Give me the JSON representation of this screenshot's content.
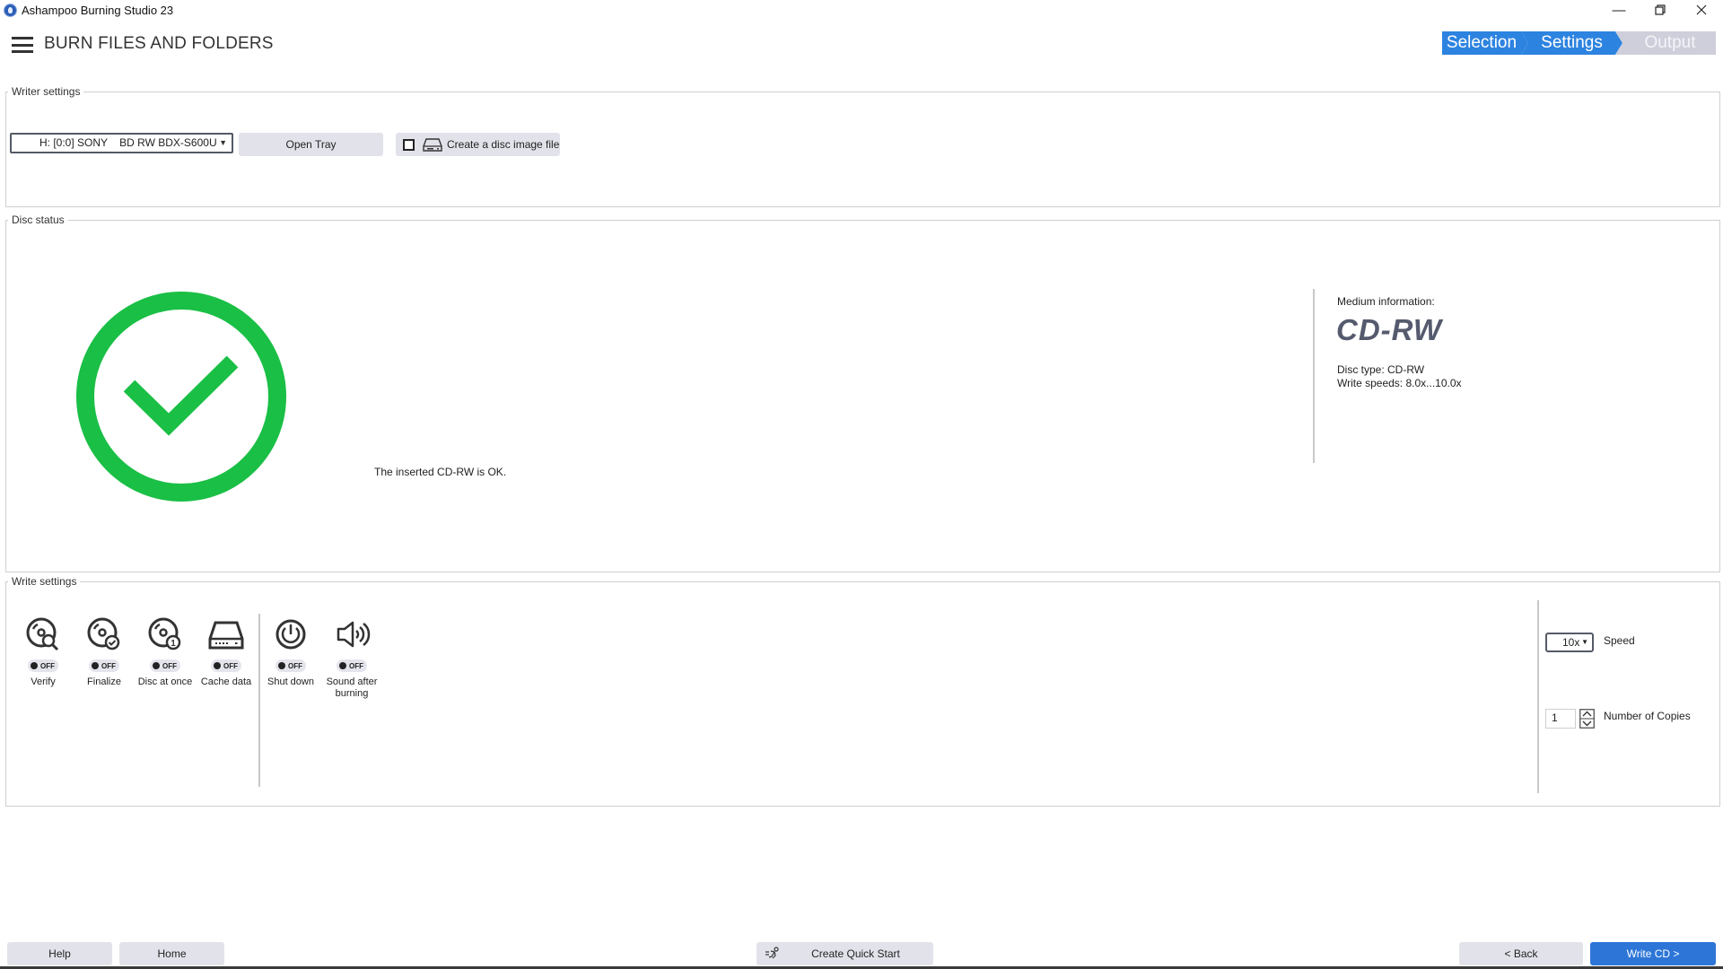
{
  "window": {
    "title": "Ashampoo Burning Studio 23",
    "controls": [
      "minimize",
      "restore",
      "close"
    ]
  },
  "header": {
    "menu_icon": "hamburger-menu-icon",
    "page_title": "BURN FILES AND FOLDERS",
    "steps": [
      {
        "label": "Selection",
        "state": "done"
      },
      {
        "label": "Settings",
        "state": "current"
      },
      {
        "label": "Output",
        "state": "pending"
      }
    ]
  },
  "writer_settings": {
    "group_label": "Writer settings",
    "drive": "H: [0:0] SONY    BD RW BDX-S600U",
    "open_tray_label": "Open Tray",
    "disc_image_label": "Create a disc image file",
    "disc_image_checked": false
  },
  "disc_status": {
    "group_label": "Disc status",
    "status_icon": "check-circle-icon",
    "status_color": "#1abf45",
    "message": "The inserted CD-RW is OK.",
    "medium_info_label": "Medium information:",
    "medium_type": "CD-RW",
    "disc_type": "Disc type: CD-RW",
    "write_speeds": "Write speeds: 8.0x...10.0x"
  },
  "write_settings": {
    "group_label": "Write settings",
    "options": [
      {
        "label": "Verify",
        "icon": "disc-verify-icon",
        "state": "OFF"
      },
      {
        "label": "Finalize",
        "icon": "disc-finalize-icon",
        "state": "OFF"
      },
      {
        "label": "Disc at once",
        "icon": "disc-at-once-icon",
        "state": "OFF"
      },
      {
        "label": "Cache data",
        "icon": "drive-cache-icon",
        "state": "OFF"
      },
      {
        "label": "Shut down",
        "icon": "power-icon",
        "state": "OFF"
      },
      {
        "label": "Sound after burning",
        "icon": "speaker-icon",
        "state": "OFF"
      }
    ],
    "speed_value": "10x",
    "speed_label": "Speed",
    "copies_value": "1",
    "copies_label": "Number of Copies"
  },
  "footer": {
    "help": "Help",
    "home": "Home",
    "quick_start": "Create Quick Start",
    "back": "< Back",
    "write": "Write CD >"
  },
  "colors": {
    "accent": "#2d83e0",
    "primary_button": "#2d76d8",
    "step_pending": "#cfcfdc"
  }
}
